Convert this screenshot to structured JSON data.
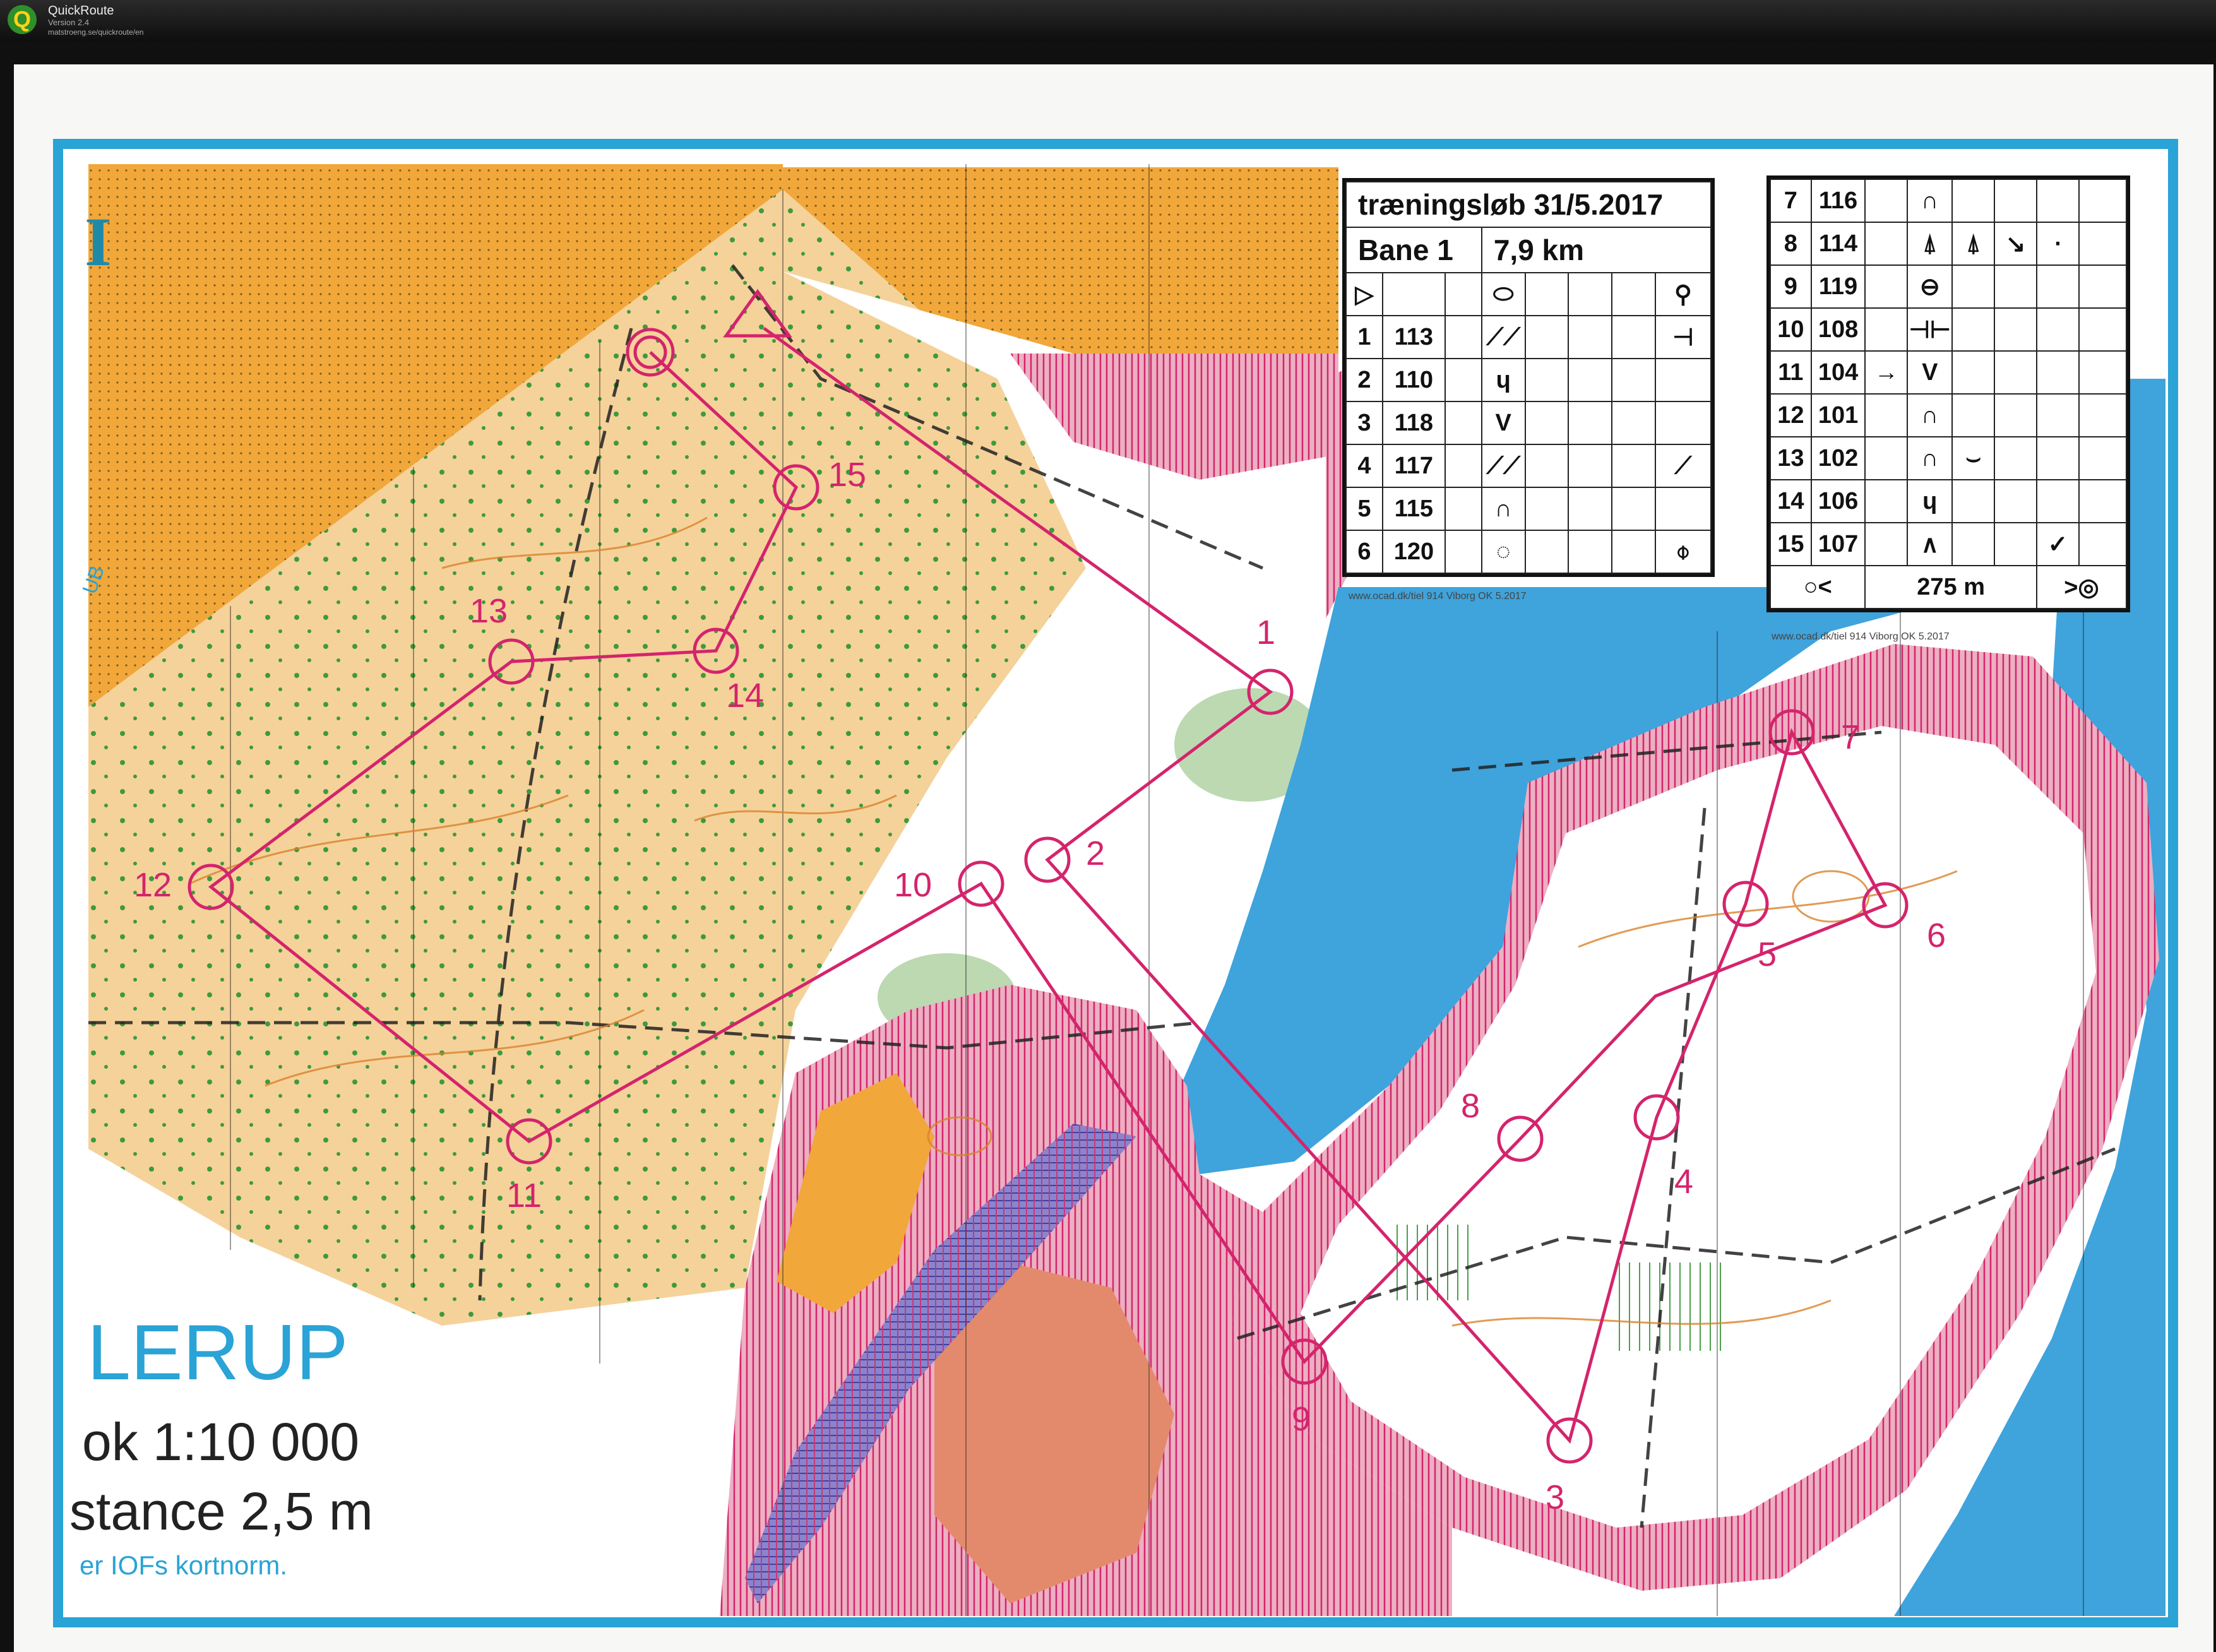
{
  "app": {
    "name": "QuickRoute",
    "version": "Version 2.4",
    "url": "matstroeng.se/quickroute/en",
    "logo_letter": "Q"
  },
  "colors": {
    "course_purple": "#d4246c",
    "water_blue": "#3fa3dc",
    "open_land_yellow": "#f5c877",
    "rough_open_orange": "#f1a73a",
    "contour_brown": "#d9822b",
    "vegetation_green": "#bcd9b2",
    "frame_blue": "#2aa3d6"
  },
  "map_text": {
    "corner_letter": "I",
    "map_name": "LERUP",
    "scale": "ok 1:10 000",
    "contour_interval": "stance 2,5 m",
    "norm_note": "er IOFs kortnorm.",
    "side_label": "UB"
  },
  "course_table_1": {
    "title": "træningsløb 31/5.2017",
    "course": "Bane 1",
    "length": "7,9 km",
    "start_symbol": "▷",
    "rows": [
      {
        "num": "1",
        "code": "113",
        "sym1": "⟋⟋",
        "sym2": "⊣"
      },
      {
        "num": "2",
        "code": "110",
        "sym1": "ɥ",
        "sym2": ""
      },
      {
        "num": "3",
        "code": "118",
        "sym1": "V",
        "sym2": ""
      },
      {
        "num": "4",
        "code": "117",
        "sym1": "⟋⟋",
        "sym2": "⟋"
      },
      {
        "num": "5",
        "code": "115",
        "sym1": "∩",
        "sym2": ""
      },
      {
        "num": "6",
        "code": "120",
        "sym1": "◌",
        "sym2": "⌽"
      }
    ],
    "footer": "www.ocad.dk/tiel 914 Viborg OK 5.2017"
  },
  "course_table_2": {
    "rows": [
      {
        "num": "7",
        "code": "116",
        "pre": "",
        "sym1": "∩",
        "sym2": "",
        "sym3": "",
        "sym4": ""
      },
      {
        "num": "8",
        "code": "114",
        "pre": "",
        "sym1": "⍋",
        "sym2": "⍋",
        "sym3": "↘",
        "sym4": "⋅"
      },
      {
        "num": "9",
        "code": "119",
        "pre": "",
        "sym1": "⊖",
        "sym2": "",
        "sym3": "",
        "sym4": ""
      },
      {
        "num": "10",
        "code": "108",
        "pre": "",
        "sym1": "⊣⊢",
        "sym2": "",
        "sym3": "",
        "sym4": ""
      },
      {
        "num": "11",
        "code": "104",
        "pre": "→",
        "sym1": "V",
        "sym2": "",
        "sym3": "",
        "sym4": ""
      },
      {
        "num": "12",
        "code": "101",
        "pre": "",
        "sym1": "∩",
        "sym2": "",
        "sym3": "",
        "sym4": ""
      },
      {
        "num": "13",
        "code": "102",
        "pre": "",
        "sym1": "∩",
        "sym2": "⌣",
        "sym3": "",
        "sym4": ""
      },
      {
        "num": "14",
        "code": "106",
        "pre": "",
        "sym1": "ɥ",
        "sym2": "",
        "sym3": "",
        "sym4": ""
      },
      {
        "num": "15",
        "code": "107",
        "pre": "",
        "sym1": "∧",
        "sym2": "",
        "sym3": "",
        "sym4": "✓"
      }
    ],
    "finish_distance": "275 m",
    "finish_left": "○<",
    "finish_right": ">◎",
    "footer": "www.ocad.dk/tiel 914 Viborg OK 5.2017"
  },
  "controls": [
    {
      "label": "1"
    },
    {
      "label": "2"
    },
    {
      "label": "3"
    },
    {
      "label": "4"
    },
    {
      "label": "5"
    },
    {
      "label": "6"
    },
    {
      "label": "7"
    },
    {
      "label": "8"
    },
    {
      "label": "9"
    },
    {
      "label": "10"
    },
    {
      "label": "11"
    },
    {
      "label": "12"
    },
    {
      "label": "13"
    },
    {
      "label": "14"
    },
    {
      "label": "15"
    }
  ]
}
